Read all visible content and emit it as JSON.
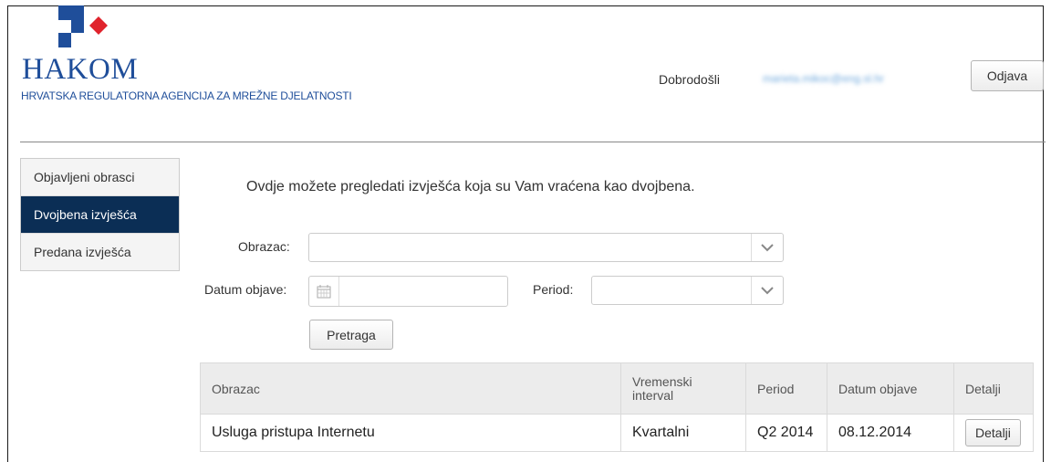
{
  "header": {
    "logo_name": "HAKOM",
    "logo_subtitle": "HRVATSKA REGULATORNA AGENCIJA ZA MREŽNE DJELATNOSTI",
    "welcome_label": "Dobrodošli",
    "user_email": "marieta.mikoc@eng.sl.hr",
    "logout_label": "Odjava",
    "brand_blue": "#1f4e9a",
    "brand_red": "#e0232c"
  },
  "sidebar": {
    "items": [
      {
        "label": "Objavljeni obrasci"
      },
      {
        "label": "Dvojbena izvješća"
      },
      {
        "label": "Predana izvješća"
      }
    ],
    "active_color": "#0b2e55"
  },
  "main": {
    "intro": "Ovdje možete pregledati izvješća koja su Vam vraćena kao dvojbena.",
    "form": {
      "obrazac_label": "Obrazac:",
      "obrazac_value": "",
      "datum_label": "Datum objave:",
      "datum_value": "",
      "period_label": "Period:",
      "period_value": "",
      "search_label": "Pretraga"
    },
    "table": {
      "headers": [
        "Obrazac",
        "Vremenski interval",
        "Period",
        "Datum objave",
        "Detalji"
      ],
      "rows": [
        {
          "obrazac": "Usluga pristupa Internetu",
          "interval": "Kvartalni",
          "period": "Q2 2014",
          "datum": "08.12.2014",
          "detalji": "Detalji"
        }
      ]
    }
  }
}
